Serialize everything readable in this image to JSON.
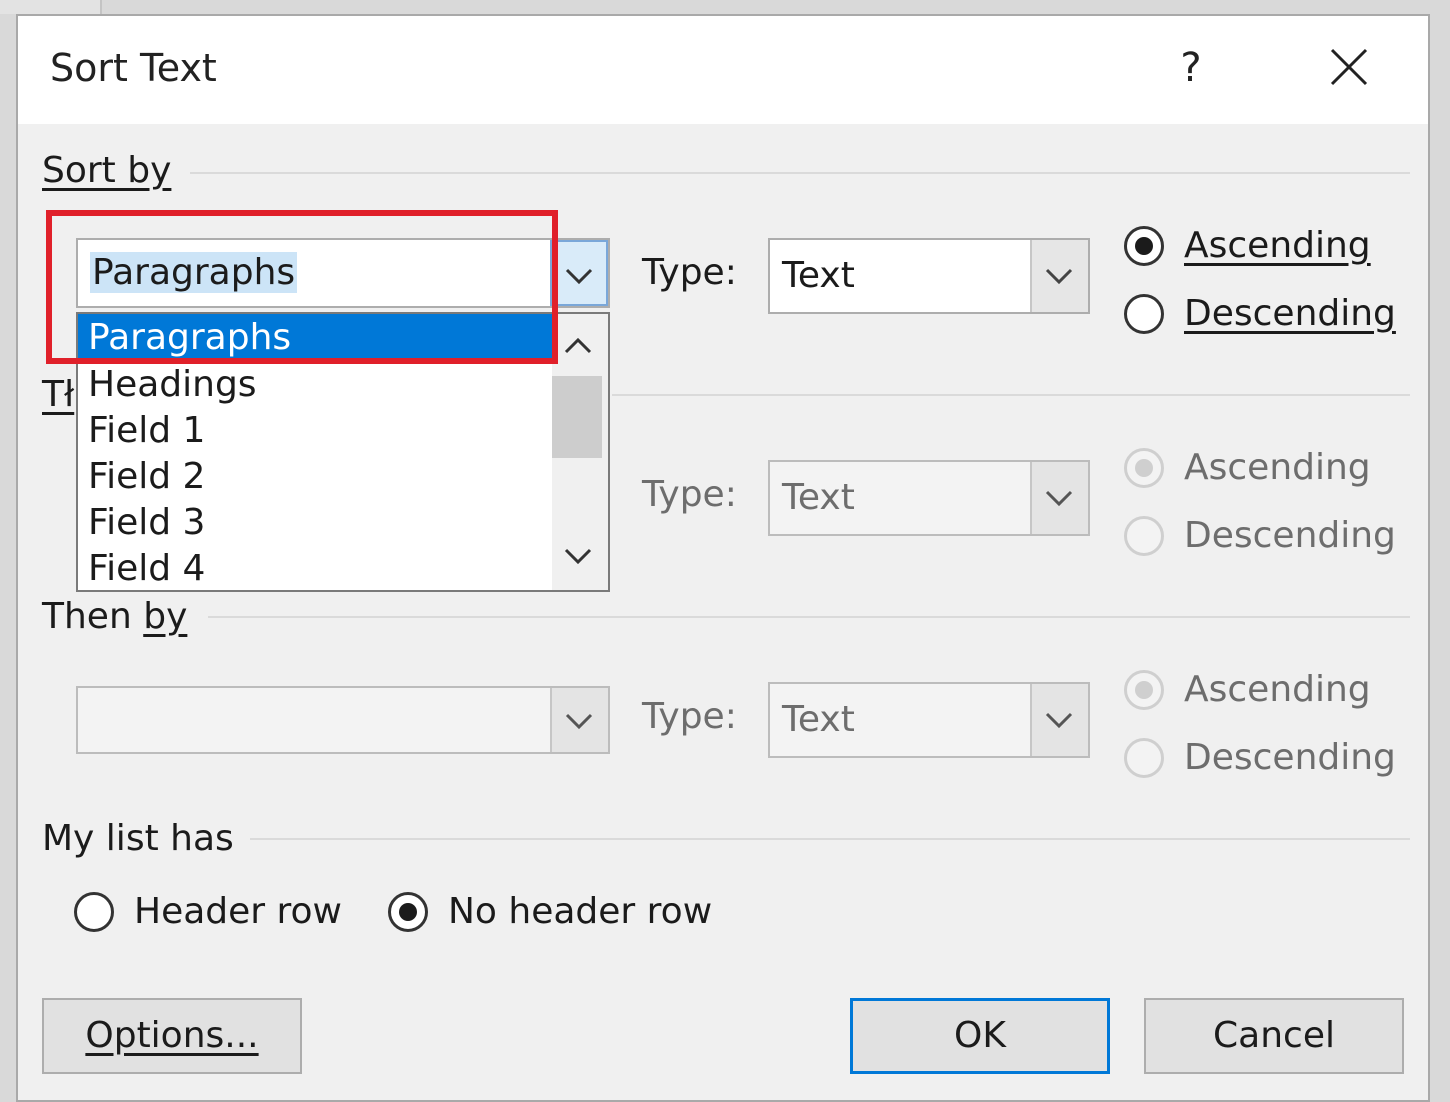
{
  "dialog": {
    "title": "Sort Text",
    "help_label": "?",
    "close_icon": "close-icon"
  },
  "sort_by": {
    "group_label": "Sort by",
    "combo_value": "Paragraphs",
    "dropdown_open": true,
    "dropdown_items": [
      "Paragraphs",
      "Headings",
      "Field 1",
      "Field 2",
      "Field 3",
      "Field 4"
    ],
    "selected_index": 0,
    "type_label": "Type:",
    "type_value": "Text",
    "ascending_label": "Ascending",
    "descending_label": "Descending",
    "order": "ascending"
  },
  "then_by_1": {
    "group_label_partial": "Tł",
    "type_label": "Type:",
    "type_value": "Text",
    "ascending_label": "Ascending",
    "descending_label": "Descending",
    "disabled": true
  },
  "then_by_2": {
    "group_label": "Then by",
    "combo_value": "",
    "type_label": "Type:",
    "type_value": "Text",
    "ascending_label": "Ascending",
    "descending_label": "Descending",
    "disabled": true
  },
  "list_header": {
    "group_label": "My list has",
    "header_row_label": "Header row",
    "no_header_row_label": "No header row",
    "selected": "no_header_row"
  },
  "buttons": {
    "options_label": "Options...",
    "ok_label": "OK",
    "cancel_label": "Cancel"
  },
  "colors": {
    "selection_blue": "#0078d7",
    "highlight_box_red": "#e0202a",
    "dialog_bg": "#f0f0f0"
  }
}
